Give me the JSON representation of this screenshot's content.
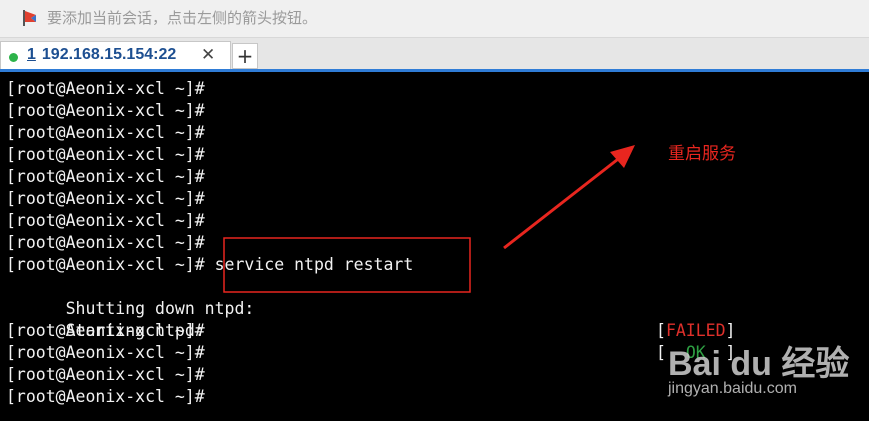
{
  "hint_bar": {
    "text": "要添加当前会话，点击左侧的箭头按钮。",
    "flag_icon": "session-flag-icon",
    "flag_color": "#e0402f"
  },
  "tabs": [
    {
      "number": "1",
      "title": "192.168.15.154:22",
      "status_color": "#2db34a",
      "close_label": "✕"
    }
  ],
  "new_tab_label": "+",
  "terminal": {
    "lines": [
      "[root@Aeonix-xcl ~]#",
      "[root@Aeonix-xcl ~]#",
      "[root@Aeonix-xcl ~]#",
      "[root@Aeonix-xcl ~]#",
      "[root@Aeonix-xcl ~]#",
      "[root@Aeonix-xcl ~]#",
      "[root@Aeonix-xcl ~]#",
      "[root@Aeonix-xcl ~]#",
      "[root@Aeonix-xcl ~]# service ntpd restart",
      "Shutting down ntpd:",
      "Starting ntpd:",
      "[root@Aeonix-xcl ~]#",
      "[root@Aeonix-xcl ~]#",
      "[root@Aeonix-xcl ~]#",
      "[root@Aeonix-xcl ~]#"
    ],
    "status_failed": {
      "open": "[",
      "word": "FAILED",
      "close": "]"
    },
    "status_ok": {
      "open": "[  ",
      "word": "OK",
      "close": "  ]"
    }
  },
  "annotation": {
    "text": "重启服务",
    "color": "#e8261f"
  },
  "watermark": {
    "main": "Bai du 经验",
    "sub": "jingyan.baidu.com"
  }
}
